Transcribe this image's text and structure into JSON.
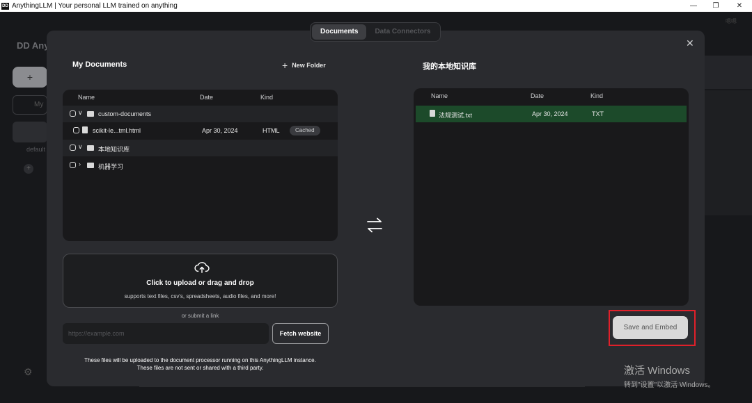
{
  "window": {
    "logo_text": "DD",
    "title": "AnythingLLM | Your personal LLM trained on anything",
    "minimize": "—",
    "maximize": "❐",
    "close": "✕"
  },
  "background": {
    "brand": "DD Any",
    "search_placeholder": "My",
    "workspace_label": "default",
    "top_right": "嗯嗯"
  },
  "tabs": [
    {
      "label": "Documents",
      "active": true
    },
    {
      "label": "Data Connectors",
      "active": false
    }
  ],
  "left_panel": {
    "title": "My Documents",
    "new_folder_label": "New Folder",
    "columns": [
      "Name",
      "Date",
      "Kind"
    ],
    "rows": [
      {
        "type": "folder",
        "name": "custom-documents",
        "expanded": true
      },
      {
        "type": "file",
        "name": "scikit-le...tml.html",
        "date": "Apr 30, 2024",
        "kind": "HTML",
        "badge": "Cached"
      },
      {
        "type": "folder",
        "name": "本地知识库",
        "expanded": true
      },
      {
        "type": "folder",
        "name": "机器学习",
        "expanded": false
      }
    ],
    "upload": {
      "main": "Click to upload or drag and drop",
      "sub": "supports text files, csv's, spreadsheets, audio files, and more!"
    },
    "or_submit": "or submit a link",
    "url_placeholder": "https://example.com",
    "fetch_label": "Fetch website",
    "disclaimer_line1": "These files will be uploaded to the document processor running on this AnythingLLM instance.",
    "disclaimer_line2": "These files are not sent or shared with a third party."
  },
  "right_panel": {
    "title": "我的本地知识库",
    "columns": [
      "Name",
      "Date",
      "Kind"
    ],
    "rows": [
      {
        "type": "file",
        "name": "法规测试.txt",
        "date": "Apr 30, 2024",
        "kind": "TXT"
      }
    ],
    "save_label": "Save and Embed"
  },
  "windows_activation": {
    "line1": "激活 Windows",
    "line2": "转到\"设置\"以激活 Windows。"
  },
  "colors": {
    "modal_bg": "#2a2b2f",
    "selected_row": "#1c4a2a",
    "highlight": "#e0202a"
  }
}
